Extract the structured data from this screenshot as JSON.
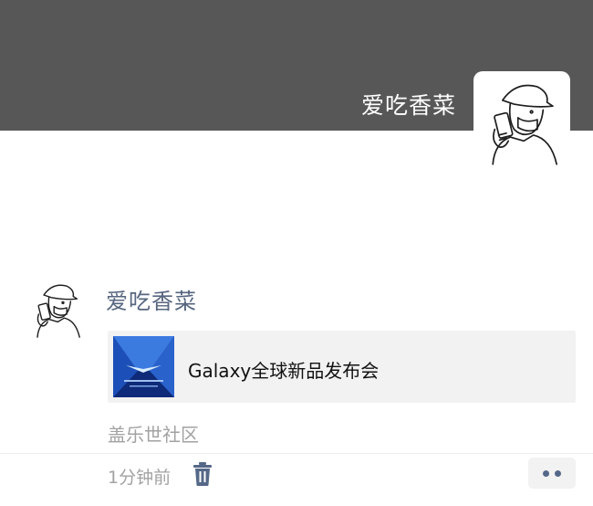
{
  "cover": {
    "username": "爱吃香菜",
    "avatar_icon": "person-with-phone-sketch-icon"
  },
  "post": {
    "username": "爱吃香菜",
    "avatar_icon": "person-with-phone-sketch-icon",
    "link": {
      "thumbnail_icon": "galaxy-event-poster-thumbnail",
      "title": "Galaxy全球新品发布会"
    },
    "location": "盖乐世社区",
    "time": "1分钟前",
    "delete_icon": "trash-icon",
    "more_icon": "more-dots-icon"
  },
  "colors": {
    "cover_bg": "#575757",
    "username_blue": "#56657f",
    "card_bg": "#f2f2f2",
    "muted_text": "#a2a2a2",
    "dots": "#556888"
  }
}
